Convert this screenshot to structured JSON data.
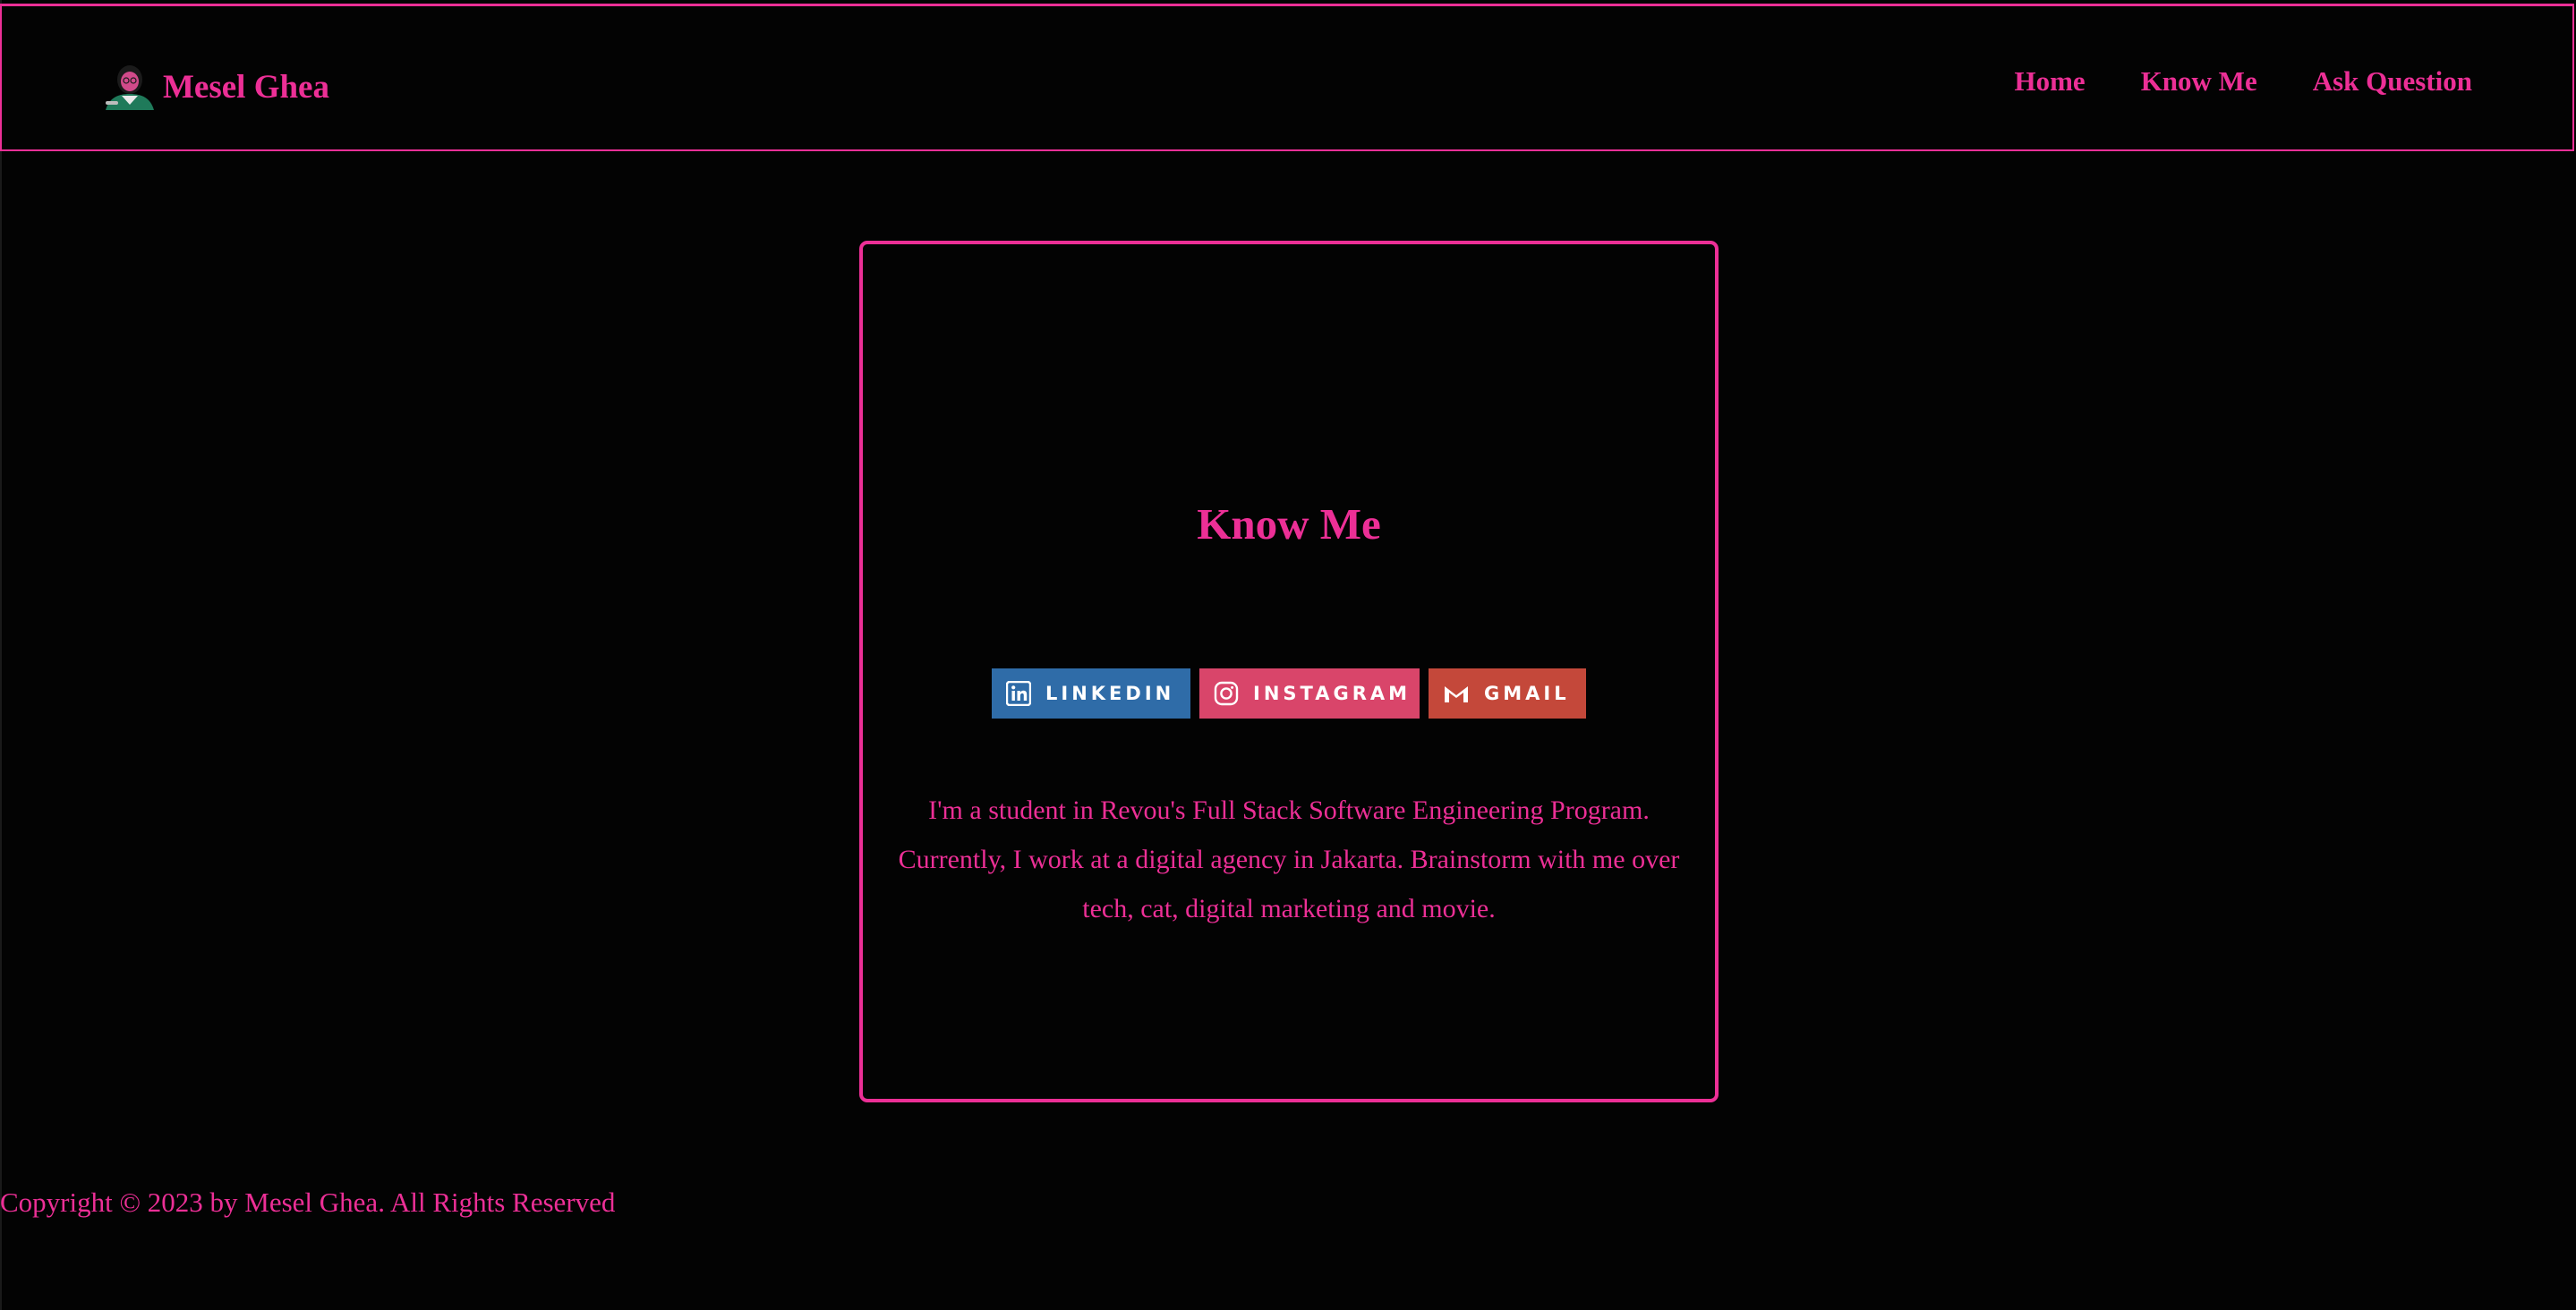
{
  "header": {
    "brand_name": "Mesel Ghea",
    "nav": [
      {
        "label": "Home"
      },
      {
        "label": "Know Me"
      },
      {
        "label": "Ask Question"
      }
    ]
  },
  "card": {
    "title": "Know Me",
    "badges": [
      {
        "label": "LINKEDIN",
        "icon": "linkedin-icon",
        "color": "#2f6ca8"
      },
      {
        "label": "INSTAGRAM",
        "icon": "instagram-icon",
        "color": "#d9456a"
      },
      {
        "label": "GMAIL",
        "icon": "gmail-icon",
        "color": "#c4483a"
      }
    ],
    "bio": "I'm a student in Revou's Full Stack Software Engineering Program. Currently, I work at a digital agency in Jakarta. Brainstorm with me over tech, cat, digital marketing and movie."
  },
  "footer": {
    "copyright": "Copyright © 2023 by Mesel Ghea. All Rights Reserved"
  },
  "colors": {
    "accent": "#ec2f96",
    "background": "#030303"
  }
}
